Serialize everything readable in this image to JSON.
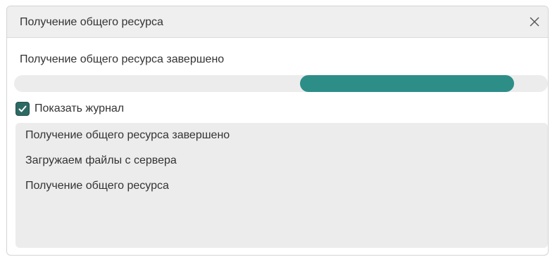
{
  "dialog": {
    "title": "Получение общего ресурса",
    "close_icon": "close-icon"
  },
  "status": {
    "text": "Получение общего ресурса завершено"
  },
  "progress": {
    "indeterminate": true,
    "segment_start_fraction": 0.535,
    "segment_end_fraction": 0.937,
    "color": "#2d8e88"
  },
  "log_toggle": {
    "label": "Показать журнал",
    "checked": true,
    "accent": "#2d6a63"
  },
  "log": {
    "lines": [
      "Получение общего ресурса завершено",
      "Загружаем файлы с сервера",
      "Получение общего ресурса"
    ]
  }
}
